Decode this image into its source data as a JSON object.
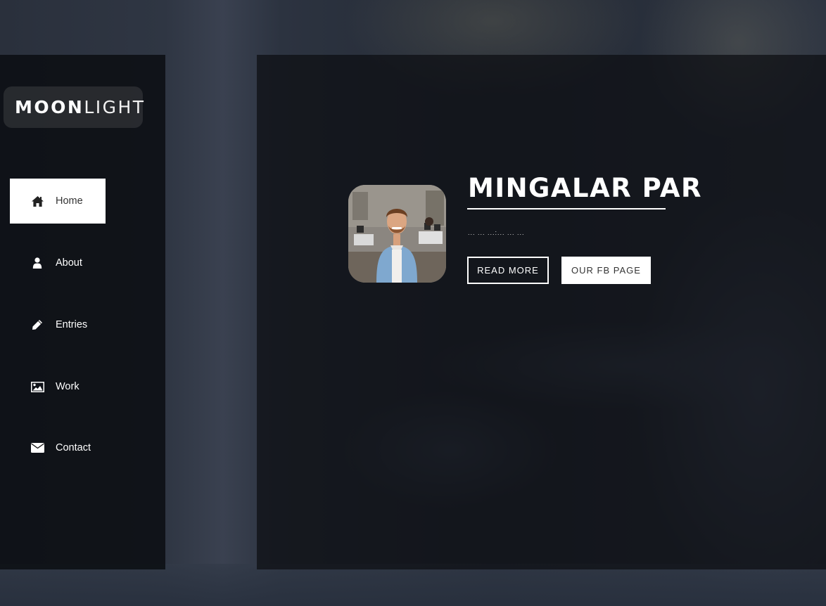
{
  "logo": {
    "bold_text": "MOON",
    "light_text": "LIGHT"
  },
  "nav": {
    "items": [
      {
        "label": "Home",
        "icon": "home-icon",
        "active": true
      },
      {
        "label": "About",
        "icon": "user-icon",
        "active": false
      },
      {
        "label": "Entries",
        "icon": "pencil-icon",
        "active": false
      },
      {
        "label": "Work",
        "icon": "image-icon",
        "active": false
      },
      {
        "label": "Contact",
        "icon": "envelope-icon",
        "active": false
      }
    ]
  },
  "hero": {
    "title": "MINGALAR PAR",
    "subtitle": "... ... ...:... ... ...",
    "read_more_label": "READ MORE",
    "fb_page_label": "OUR FB PAGE",
    "avatar_alt": "profile photo"
  },
  "colors": {
    "sidebar_bg": "#0a0c10",
    "active_nav_bg": "#ffffff",
    "text_light": "#ffffff",
    "text_dark": "#333333"
  }
}
